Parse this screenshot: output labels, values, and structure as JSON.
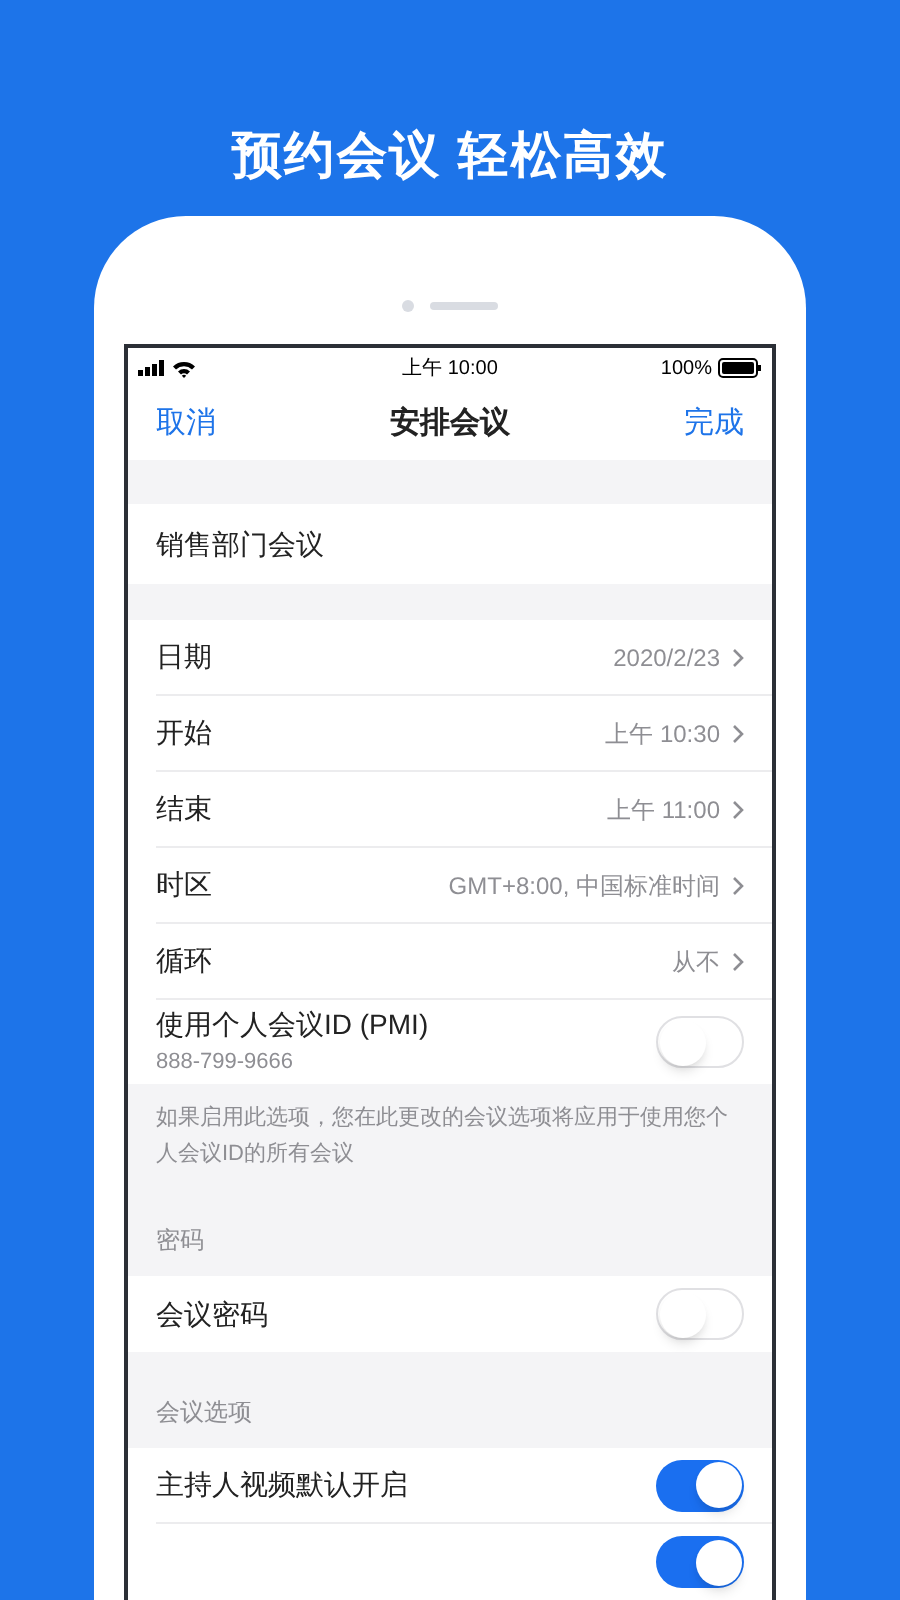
{
  "headline": "预约会议 轻松高效",
  "status_bar": {
    "time": "上午 10:00",
    "battery_text": "100%"
  },
  "nav": {
    "cancel": "取消",
    "title": "安排会议",
    "done": "完成"
  },
  "sections": [
    {
      "rows": [
        {
          "kind": "text",
          "label": "销售部门会议"
        }
      ]
    },
    {
      "rows": [
        {
          "kind": "link",
          "label": "日期",
          "value": "2020/2/23"
        },
        {
          "kind": "link",
          "label": "开始",
          "value": "上午 10:30"
        },
        {
          "kind": "link",
          "label": "结束",
          "value": "上午 11:00"
        },
        {
          "kind": "link",
          "label": "时区",
          "value": "GMT+8:00, 中国标准时间"
        },
        {
          "kind": "link",
          "label": "循环",
          "value": "从不"
        },
        {
          "kind": "toggle",
          "label": "使用个人会议ID (PMI)",
          "sublabel": "888-799-9666",
          "on": false
        }
      ],
      "note": "如果启用此选项，您在此更改的会议选项将应用于使用您个人会议ID的所有会议"
    },
    {
      "header": "密码",
      "rows": [
        {
          "kind": "toggle",
          "label": "会议密码",
          "on": false
        }
      ]
    },
    {
      "header": "会议选项",
      "rows": [
        {
          "kind": "toggle",
          "label": "主持人视频默认开启",
          "on": true
        },
        {
          "kind": "toggle",
          "on": true
        }
      ]
    }
  ]
}
